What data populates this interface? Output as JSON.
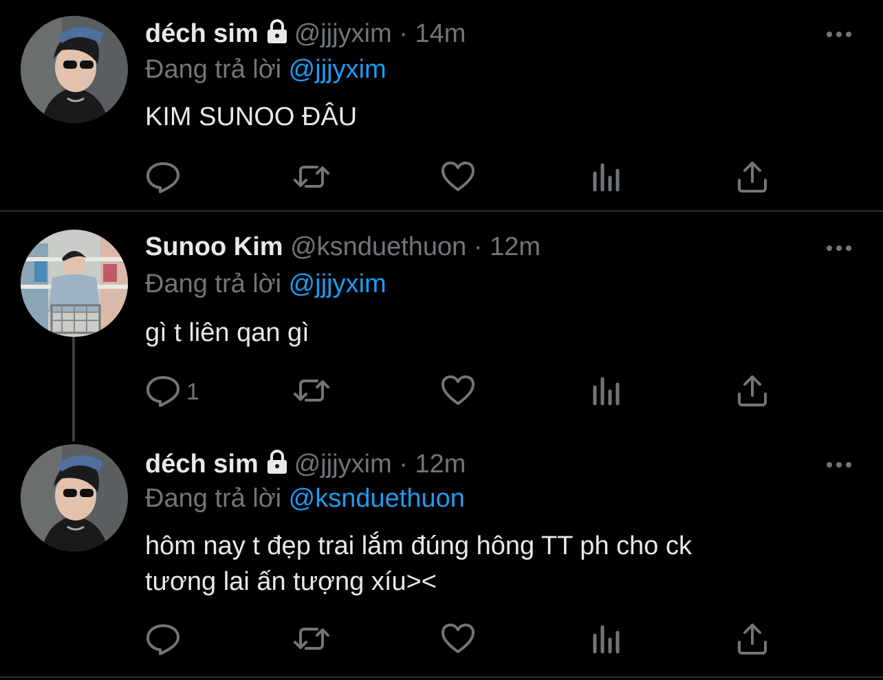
{
  "tweets": [
    {
      "display_name": "déch sim",
      "handle": "@jjjyxim",
      "separator": "·",
      "time": "14m",
      "reply_prefix": "Đang trả lời",
      "reply_to": "@jjjyxim",
      "text": "KIM SUNOO ĐÂU",
      "locked": true,
      "reply_count": ""
    },
    {
      "display_name": "Sunoo Kim",
      "handle": "@ksnduethuon",
      "separator": "·",
      "time": "12m",
      "reply_prefix": "Đang trả lời",
      "reply_to": "@jjjyxim",
      "text": "gì t liên qan gì",
      "locked": false,
      "reply_count": "1"
    },
    {
      "display_name": "déch sim",
      "handle": "@jjjyxim",
      "separator": "·",
      "time": "12m",
      "reply_prefix": "Đang trả lời",
      "reply_to": "@ksnduethuon",
      "text_line1": "hôm nay t đẹp trai lắm đúng hông TT ph cho ck",
      "text_line2": "tương lai ấn tượng xíu><",
      "locked": true,
      "reply_count": ""
    }
  ],
  "icons": {
    "reply": "reply-icon",
    "retweet": "retweet-icon",
    "like": "heart-icon",
    "views": "views-icon",
    "share": "share-icon",
    "more": "more-icon",
    "lock": "lock-icon"
  },
  "colors": {
    "background": "#000000",
    "text": "#e7e9ea",
    "muted": "#71767b",
    "mention": "#1d9bf0",
    "divider": "#2f3336"
  }
}
